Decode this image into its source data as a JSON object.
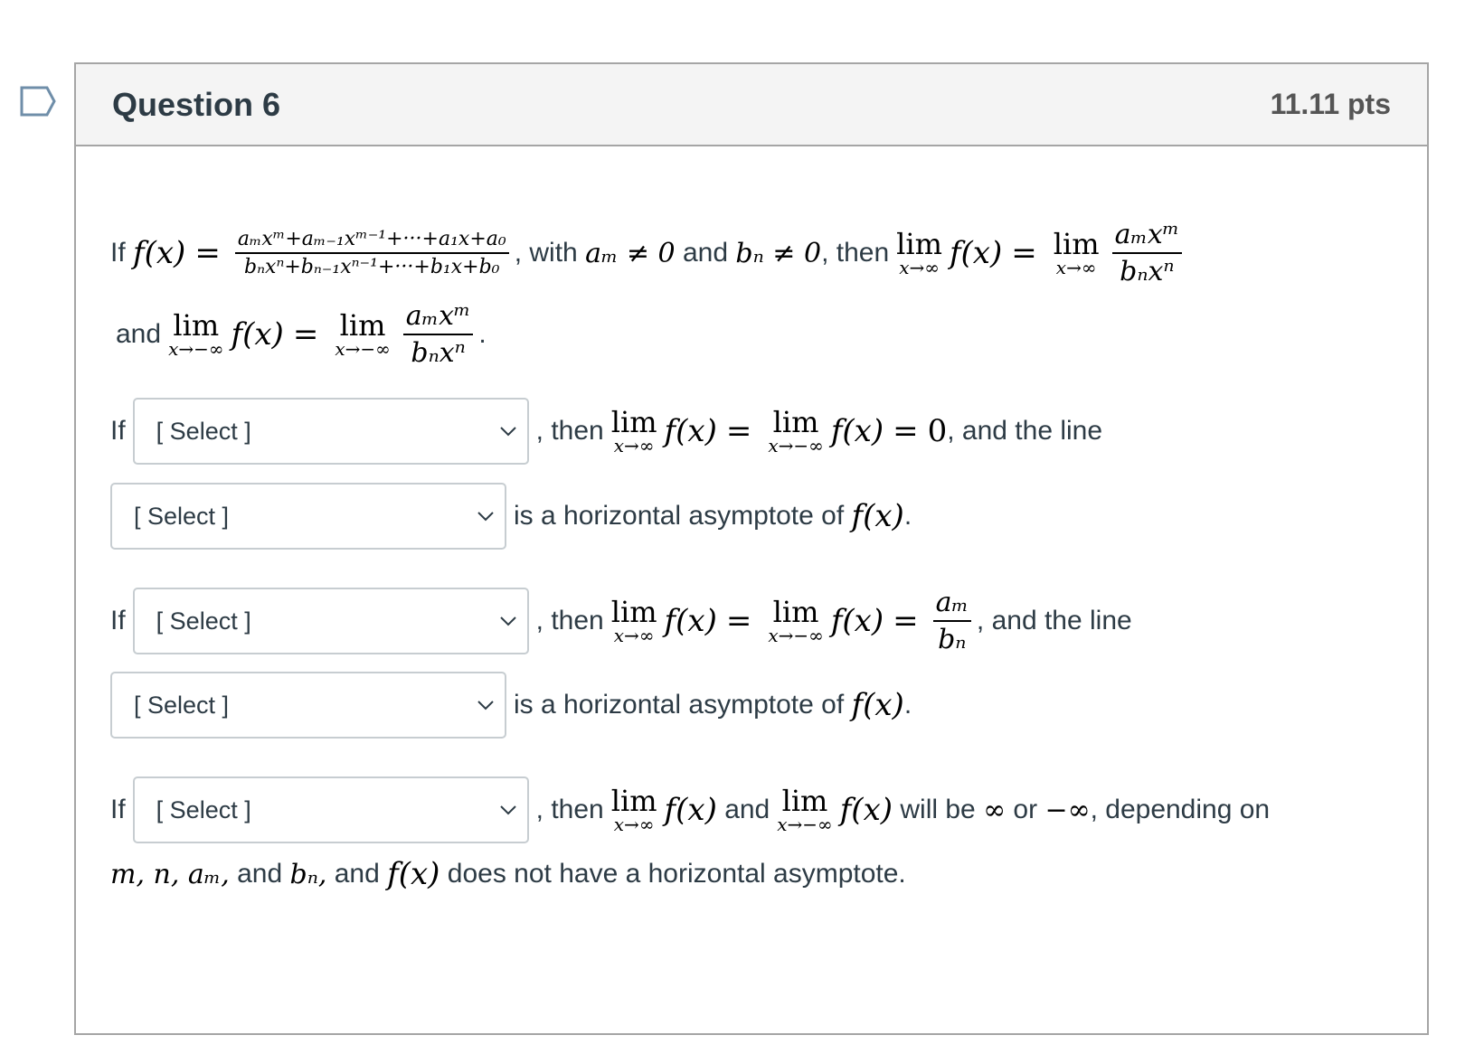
{
  "question": {
    "title": "Question 6",
    "points": "11.11 pts"
  },
  "intro": {
    "if": "If",
    "f_of_x": "f(x)",
    "equals": "=",
    "numerator": "aₘxᵐ+aₘ₋₁xᵐ⁻¹+···+a₁x+a₀",
    "denominator": "bₙxⁿ+bₙ₋₁xⁿ⁻¹+···+b₁x+b₀",
    "with": ", with",
    "am_neq": "aₘ ≠ 0",
    "and": "and",
    "bn_neq": "bₙ ≠ 0",
    "then": ", then",
    "lim": "lim",
    "to_inf": "x→∞",
    "to_neg_inf": "x→−∞",
    "ratio_num": "aₘxᵐ",
    "ratio_den": "bₙxⁿ",
    "and2": "and",
    "period": "."
  },
  "case1": {
    "if": "If",
    "select_placeholder": "[ Select ]",
    "then": ", then",
    "lim": "lim",
    "to_inf": "x→∞",
    "to_neg_inf": "x→−∞",
    "f_of_x": "f(x)",
    "eq": "=",
    "result": "0",
    "and_the_line": ", and the line",
    "select2_placeholder": "[ Select ]",
    "asymptote_text": "is a horizontal asymptote of",
    "period": "."
  },
  "case2": {
    "if": "If",
    "select_placeholder": "[ Select ]",
    "then": ", then",
    "lim": "lim",
    "to_inf": "x→∞",
    "to_neg_inf": "x→−∞",
    "f_of_x": "f(x)",
    "eq": "=",
    "result_num": "aₘ",
    "result_den": "bₙ",
    "and_the_line": ", and the line",
    "select2_placeholder": "[ Select ]",
    "asymptote_text": "is a horizontal asymptote of",
    "period": "."
  },
  "case3": {
    "if": "If",
    "select_placeholder": "[ Select ]",
    "then": ", then",
    "lim": "lim",
    "to_inf": "x→∞",
    "to_neg_inf": "x→−∞",
    "f_of_x": "f(x)",
    "and": "and",
    "will_be": "will be",
    "inf": "∞",
    "or": "or",
    "neg_inf": "−∞",
    "depending": ", depending on",
    "vars": "m, n, aₘ,",
    "and_bn": "and",
    "bn": "bₙ,",
    "and_f": "and",
    "no_asymptote": "does not have a horizontal asymptote."
  }
}
